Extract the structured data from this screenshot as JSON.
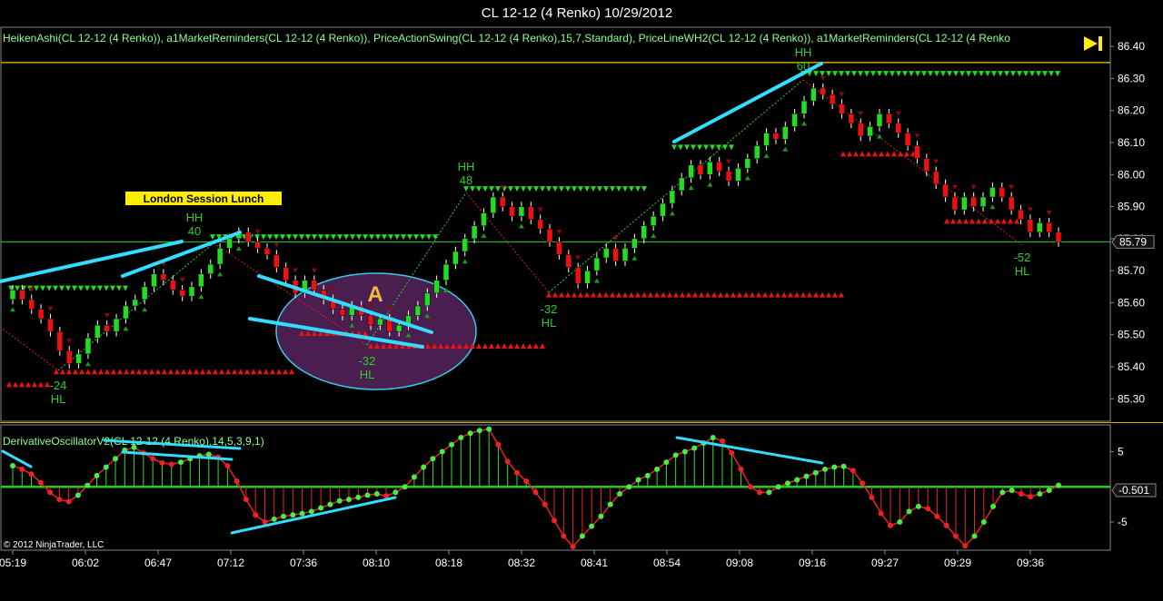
{
  "window": {
    "title": "CL 12-12 (4 Renko)  10/29/2012",
    "indicator_line": "HeikenAshi(CL 12-12 (4 Renko)), a1MarketReminders(CL 12-12 (4 Renko)), PriceActionSwing(CL 12-12 (4 Renko),15,7,Standard), PriceLineWH2(CL 12-12 (4 Renko)), a1MarketReminders(CL 12-12 (4 Renko",
    "oscillator_label": "DerivativeOscillatorV2(CL 12-12 (4 Renko),14,5,3,9,1)",
    "copyright": "© 2012 NinjaTrader, LLC",
    "session_label": "London Session Lunch",
    "annotation_letter": "A",
    "colors": {
      "up_candle": "#22dd22",
      "down_candle": "#ee1111",
      "trendline": "#33ddff",
      "price_line": "#ccaa00",
      "current_line": "#33cc33",
      "session_box": "#ffee00",
      "ellipse_fill": "#4a1f4f",
      "osc_up": "#33dd33",
      "osc_down": "#ee2222"
    }
  },
  "chart_data": [
    {
      "type": "candlestick",
      "title": "CL 12-12 (4 Renko)  10/29/2012",
      "ylim": [
        85.23,
        86.46
      ],
      "y_ticks": [
        "86.40",
        "86.30",
        "86.20",
        "86.10",
        "86.00",
        "85.90",
        "85.80",
        "85.70",
        "85.60",
        "85.50",
        "85.40",
        "85.30"
      ],
      "x_tick_labels": [
        "05:19",
        "06:02",
        "06:47",
        "07:12",
        "07:36",
        "08:10",
        "08:18",
        "08:32",
        "08:41",
        "08:54",
        "09:08",
        "09:16",
        "09:27",
        "09:29",
        "09:36"
      ],
      "current_price": 85.79,
      "current_price_label": "85.79",
      "price_line_level": 86.35,
      "closes": [
        85.64,
        85.61,
        85.58,
        85.55,
        85.51,
        85.45,
        85.41,
        85.44,
        85.49,
        85.53,
        85.51,
        85.55,
        85.59,
        85.61,
        85.65,
        85.69,
        85.67,
        85.64,
        85.62,
        85.65,
        85.69,
        85.72,
        85.77,
        85.8,
        85.82,
        85.79,
        85.77,
        85.75,
        85.71,
        85.67,
        85.63,
        85.67,
        85.64,
        85.61,
        85.58,
        85.56,
        85.59,
        85.56,
        85.53,
        85.55,
        85.51,
        85.53,
        85.56,
        85.59,
        85.63,
        85.67,
        85.72,
        85.76,
        85.8,
        85.84,
        85.88,
        85.93,
        85.9,
        85.87,
        85.9,
        85.86,
        85.83,
        85.79,
        85.75,
        85.71,
        85.66,
        85.7,
        85.74,
        85.77,
        85.73,
        85.77,
        85.8,
        85.84,
        85.87,
        85.91,
        85.95,
        85.99,
        86.03,
        86.0,
        86.04,
        86.01,
        85.98,
        86.02,
        86.05,
        86.09,
        86.13,
        86.11,
        86.15,
        86.19,
        86.23,
        86.27,
        86.25,
        86.22,
        86.19,
        86.16,
        86.12,
        86.15,
        86.19,
        86.16,
        86.13,
        86.09,
        86.05,
        86.01,
        85.97,
        85.93,
        85.89,
        85.93,
        85.9,
        85.93,
        85.96,
        85.93,
        85.89,
        85.86,
        85.82,
        85.85,
        85.82,
        85.79
      ],
      "osc_ylim": [
        -9.0,
        8.8
      ],
      "osc_ticks": [
        5,
        -5
      ],
      "osc_current_label": "-0.501",
      "osc_values": [
        3.0,
        2.5,
        1.8,
        0.6,
        -0.8,
        -1.8,
        -2.1,
        -1.2,
        0.2,
        1.6,
        2.8,
        4.0,
        5.2,
        5.6,
        4.8,
        4.0,
        3.4,
        3.2,
        3.5,
        4.0,
        4.4,
        4.6,
        4.2,
        3.0,
        0.8,
        -1.8,
        -4.0,
        -5.0,
        -4.6,
        -4.2,
        -4.0,
        -3.8,
        -3.5,
        -3.0,
        -2.5,
        -2.0,
        -1.8,
        -1.5,
        -1.2,
        -1.0,
        -1.3,
        -0.8,
        0.0,
        1.4,
        2.8,
        4.0,
        5.0,
        6.0,
        7.0,
        7.6,
        8.0,
        8.2,
        6.0,
        3.6,
        2.0,
        0.8,
        -0.8,
        -2.5,
        -4.8,
        -7.0,
        -8.5,
        -7.0,
        -5.6,
        -4.2,
        -2.5,
        -1.0,
        0.0,
        1.0,
        1.6,
        2.5,
        3.5,
        4.5,
        5.0,
        5.5,
        6.2,
        7.0,
        6.5,
        4.8,
        2.5,
        0.0,
        -0.8,
        -0.8,
        0.0,
        0.5,
        1.0,
        1.5,
        2.0,
        2.5,
        2.8,
        2.9,
        2.3,
        0.5,
        -1.5,
        -3.8,
        -5.5,
        -5.0,
        -3.5,
        -2.8,
        -3.1,
        -4.2,
        -5.5,
        -7.0,
        -8.4,
        -7.0,
        -5.0,
        -2.8,
        -0.8,
        -0.5,
        -1.0,
        -1.4,
        -1.0,
        -0.5,
        0.2
      ]
    }
  ]
}
